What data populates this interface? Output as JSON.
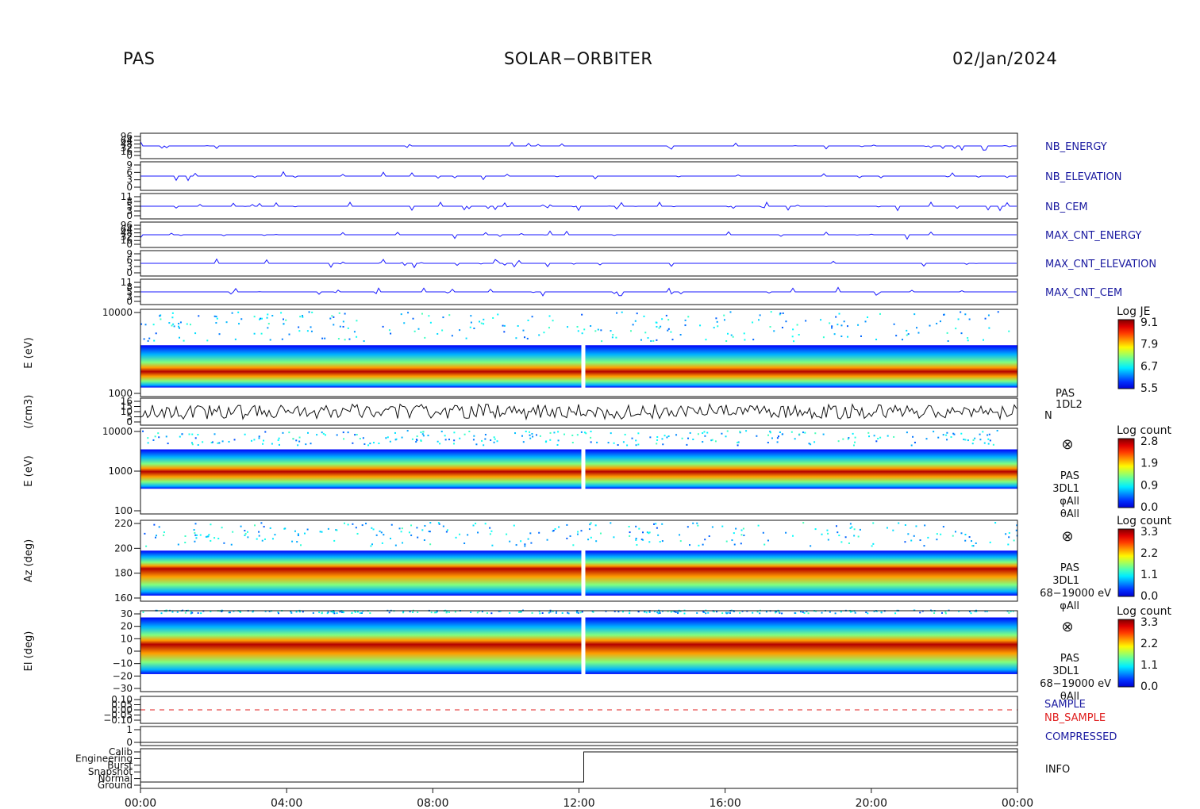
{
  "header": {
    "left": "PAS",
    "center": "SOLAR−ORBITER",
    "right": "02/Jan/2024"
  },
  "chart_data": {
    "type": "heatmap",
    "x_ticks": [
      "00:00",
      "04:00",
      "08:00",
      "12:00",
      "16:00",
      "20:00",
      "00:00"
    ],
    "gap_time": "12:00",
    "colors": {
      "line": "#1a1aff",
      "text": "#1a1aa0",
      "red": "#e02020"
    },
    "panels": [
      {
        "id": "nb_energy",
        "type": "line",
        "label": "NB_ENERGY",
        "label_color": "#1a1aa0",
        "yticks": [
          "96",
          "64",
          "48",
          "32",
          "16",
          "0"
        ]
      },
      {
        "id": "nb_elevation",
        "type": "line",
        "label": "NB_ELEVATION",
        "label_color": "#1a1aa0",
        "yticks": [
          "9",
          "6",
          "3",
          "0"
        ]
      },
      {
        "id": "nb_cem",
        "type": "line",
        "label": "NB_CEM",
        "label_color": "#1a1aa0",
        "yticks": [
          "11",
          "8",
          "5",
          "3",
          "0"
        ]
      },
      {
        "id": "max_cnt_energy",
        "type": "line",
        "label": "MAX_CNT_ENERGY",
        "label_color": "#1a1aa0",
        "yticks": [
          "96",
          "64",
          "48",
          "32",
          "16",
          "0"
        ]
      },
      {
        "id": "max_cnt_elevation",
        "type": "line",
        "label": "MAX_CNT_ELEVATION",
        "label_color": "#1a1aa0",
        "yticks": [
          "9",
          "6",
          "3",
          "0"
        ]
      },
      {
        "id": "max_cnt_cem",
        "type": "line",
        "label": "MAX_CNT_CEM",
        "label_color": "#1a1aa0",
        "yticks": [
          "11",
          "8",
          "5",
          "3",
          "0"
        ]
      },
      {
        "id": "pas_1dl2",
        "type": "spectrogram",
        "ylabel": "E (eV)",
        "yticks": [
          "10000",
          "1000"
        ],
        "ylim": [
          300,
          15000
        ],
        "log": true,
        "band": [
          450,
          3000
        ],
        "peak": 920,
        "colorbar": {
          "title": "Log JE",
          "ticks": [
            "9.1",
            "7.9",
            "6.7",
            "5.5"
          ]
        }
      },
      {
        "id": "density",
        "type": "line",
        "ylabel": "(/cm3)",
        "yticks": [
          "16",
          "15",
          "10",
          "5",
          "0"
        ],
        "label_lines": [
          "PAS",
          "1DL2",
          "N"
        ]
      },
      {
        "id": "pas_3dl1_e",
        "type": "spectrogram",
        "ylabel": "E (eV)",
        "yticks": [
          "10000",
          "1000",
          "100"
        ],
        "ylim": [
          80,
          12000
        ],
        "log": true,
        "band": [
          350,
          3500
        ],
        "peak": 950,
        "colorbar": {
          "title": "Log count",
          "ticks": [
            "2.8",
            "1.9",
            "0.9",
            "0.0"
          ]
        },
        "side_lines": [
          "PAS",
          "3DL1",
          "φAll",
          "θAll"
        ]
      },
      {
        "id": "pas_3dl1_az",
        "type": "spectrogram",
        "ylabel": "Az (deg)",
        "yticks": [
          "220",
          "200",
          "180",
          "160"
        ],
        "ylim": [
          153,
          225
        ],
        "band": [
          158,
          198
        ],
        "peak": 182,
        "colorbar": {
          "title": "Log count",
          "ticks": [
            "3.3",
            "2.2",
            "1.1",
            "0.0"
          ]
        },
        "side_lines": [
          "PAS",
          "3DL1",
          "68−19000 eV",
          "φAll"
        ]
      },
      {
        "id": "pas_3dl1_el",
        "type": "spectrogram",
        "ylabel": "El (deg)",
        "yticks": [
          "30",
          "20",
          "10",
          "0",
          "−10",
          "−20",
          "−30"
        ],
        "ylim": [
          -30,
          30
        ],
        "band": [
          -17,
          25
        ],
        "peak": 5,
        "colorbar": {
          "title": "Log count",
          "ticks": [
            "3.3",
            "2.2",
            "1.1",
            "0.0"
          ]
        },
        "side_lines": [
          "PAS",
          "3DL1",
          "68−19000 eV",
          "θAll"
        ]
      },
      {
        "id": "sample",
        "type": "line",
        "labels": [
          "SAMPLE",
          "NB_SAMPLE"
        ],
        "label_colors": [
          "#1a1aa0",
          "#e02020"
        ],
        "yticks": [
          "0.10",
          "0.05",
          "0.00",
          "−0.05",
          "−0.10"
        ]
      },
      {
        "id": "compressed",
        "type": "line",
        "label": "COMPRESSED",
        "label_color": "#1a1aa0",
        "yticks": [
          "1",
          "0"
        ]
      },
      {
        "id": "info",
        "type": "line",
        "label": "INFO",
        "label_color": "#111111",
        "yticks": [
          "Calib",
          "Engineering",
          "Burst",
          "Snapshot",
          "Normal",
          "Ground"
        ]
      }
    ]
  }
}
